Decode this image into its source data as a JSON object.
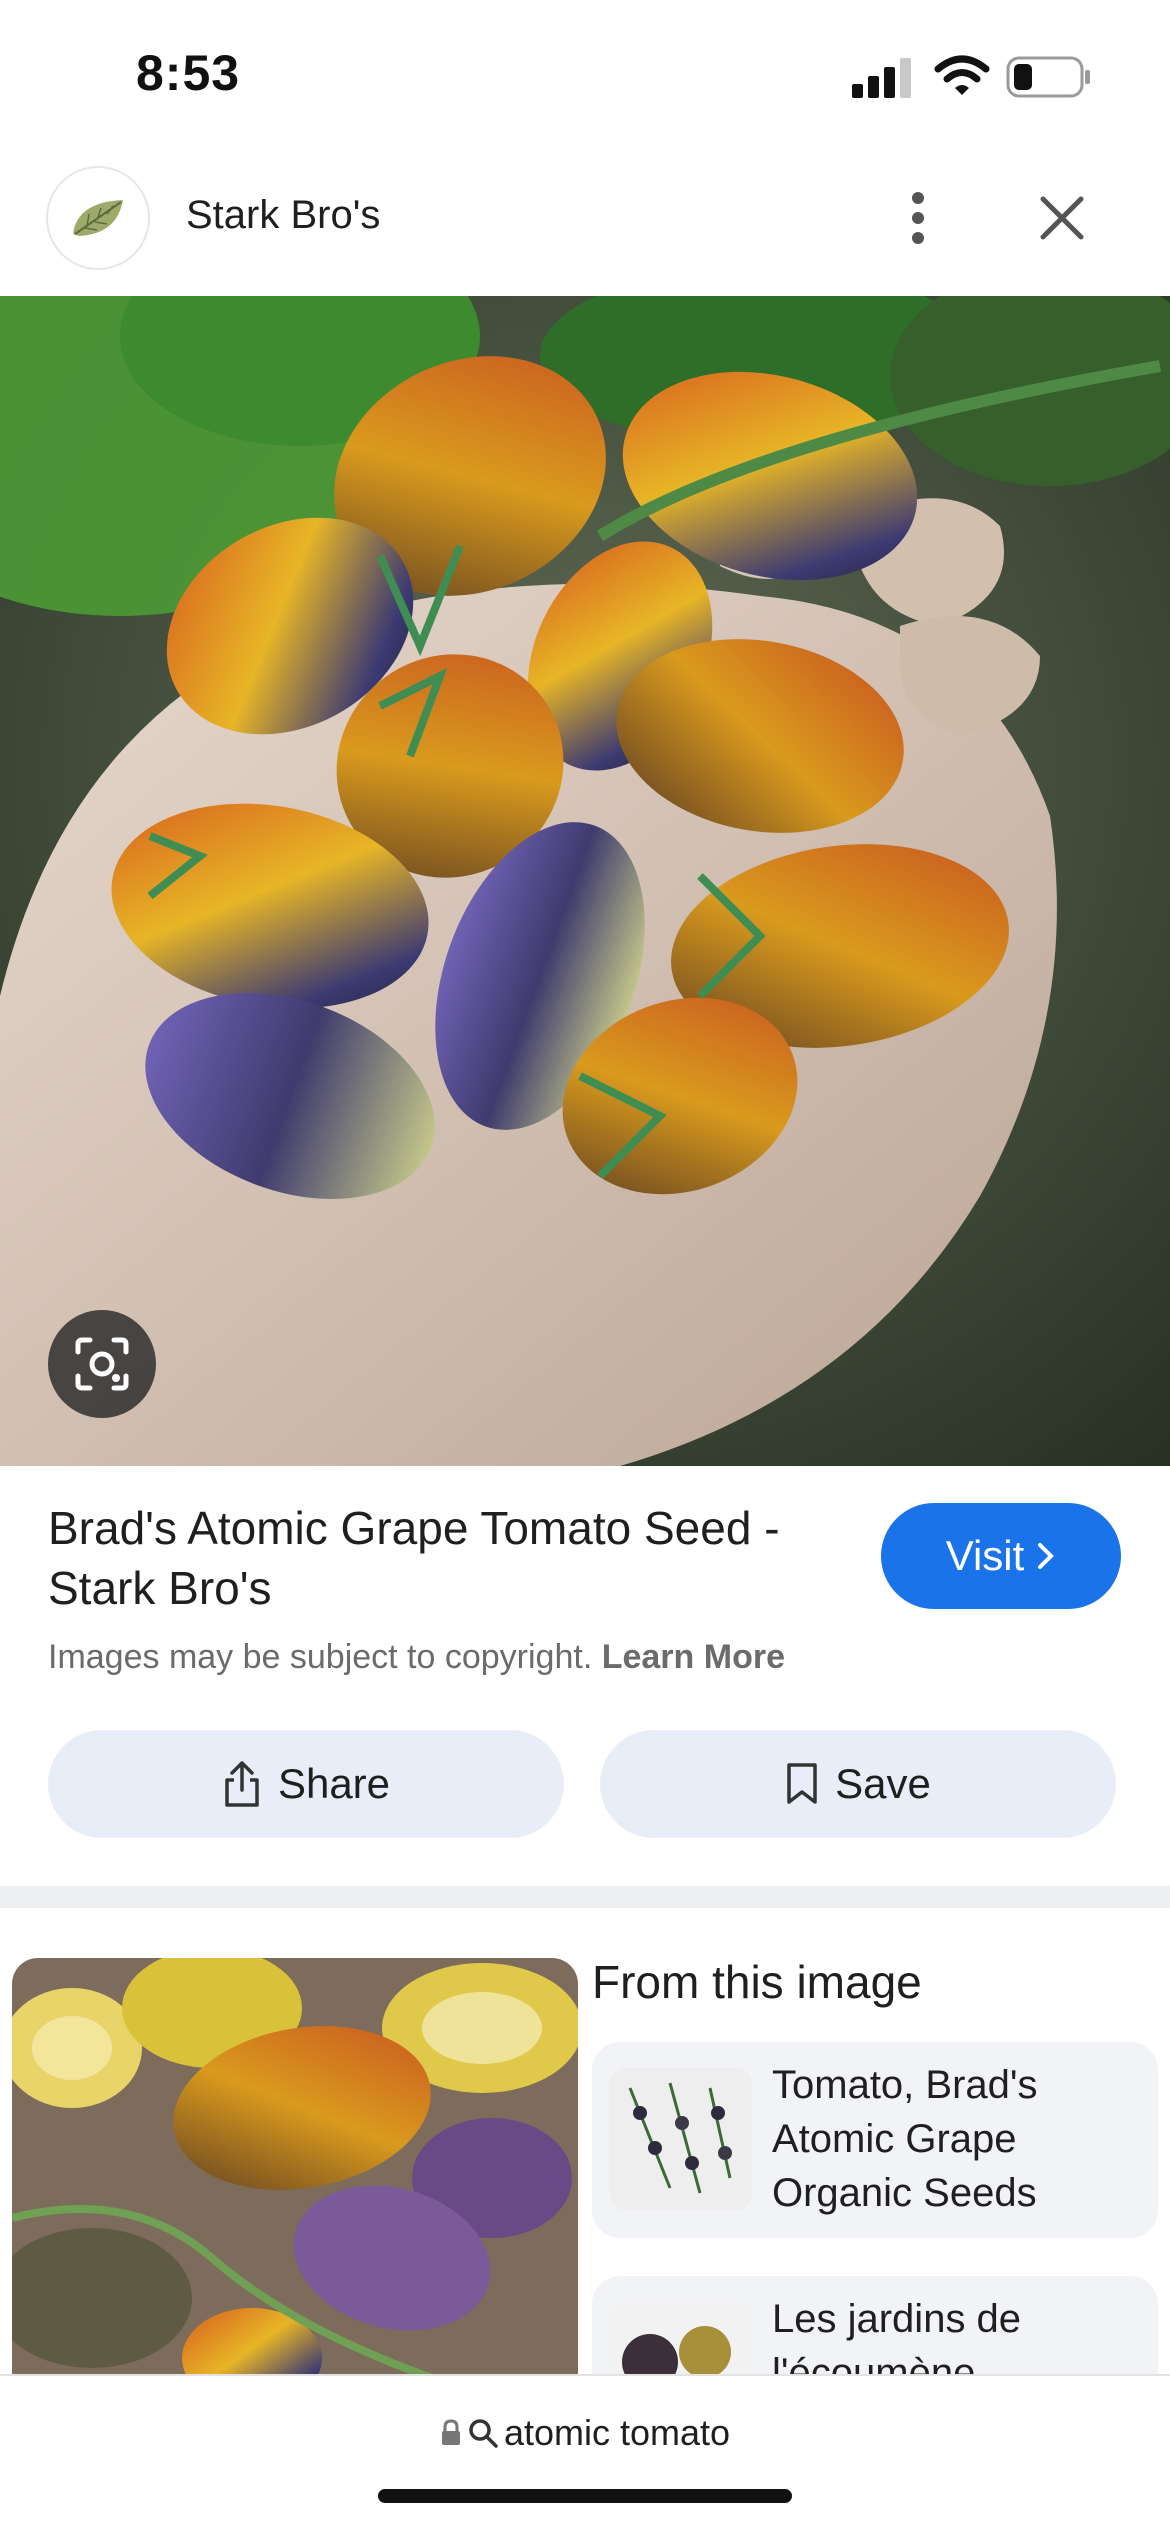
{
  "status_bar": {
    "time": "8:53"
  },
  "header": {
    "site_name": "Stark Bro's"
  },
  "result": {
    "title": "Brad's Atomic Grape Tomato Seed - Stark Bro's",
    "visit_label": "Visit",
    "copyright_text": "Images may be subject to copyright.",
    "learn_more": "Learn More",
    "share_label": "Share",
    "save_label": "Save"
  },
  "related": {
    "heading": "From this image",
    "items": [
      {
        "label": "Tomato, Brad's Atomic Grape Organic Seeds"
      },
      {
        "label": "Les jardins de l'écoumène"
      }
    ]
  },
  "bottom": {
    "query": "atomic tomato"
  },
  "colors": {
    "accent": "#1a73e8",
    "pill_bg": "#e8edf8"
  }
}
